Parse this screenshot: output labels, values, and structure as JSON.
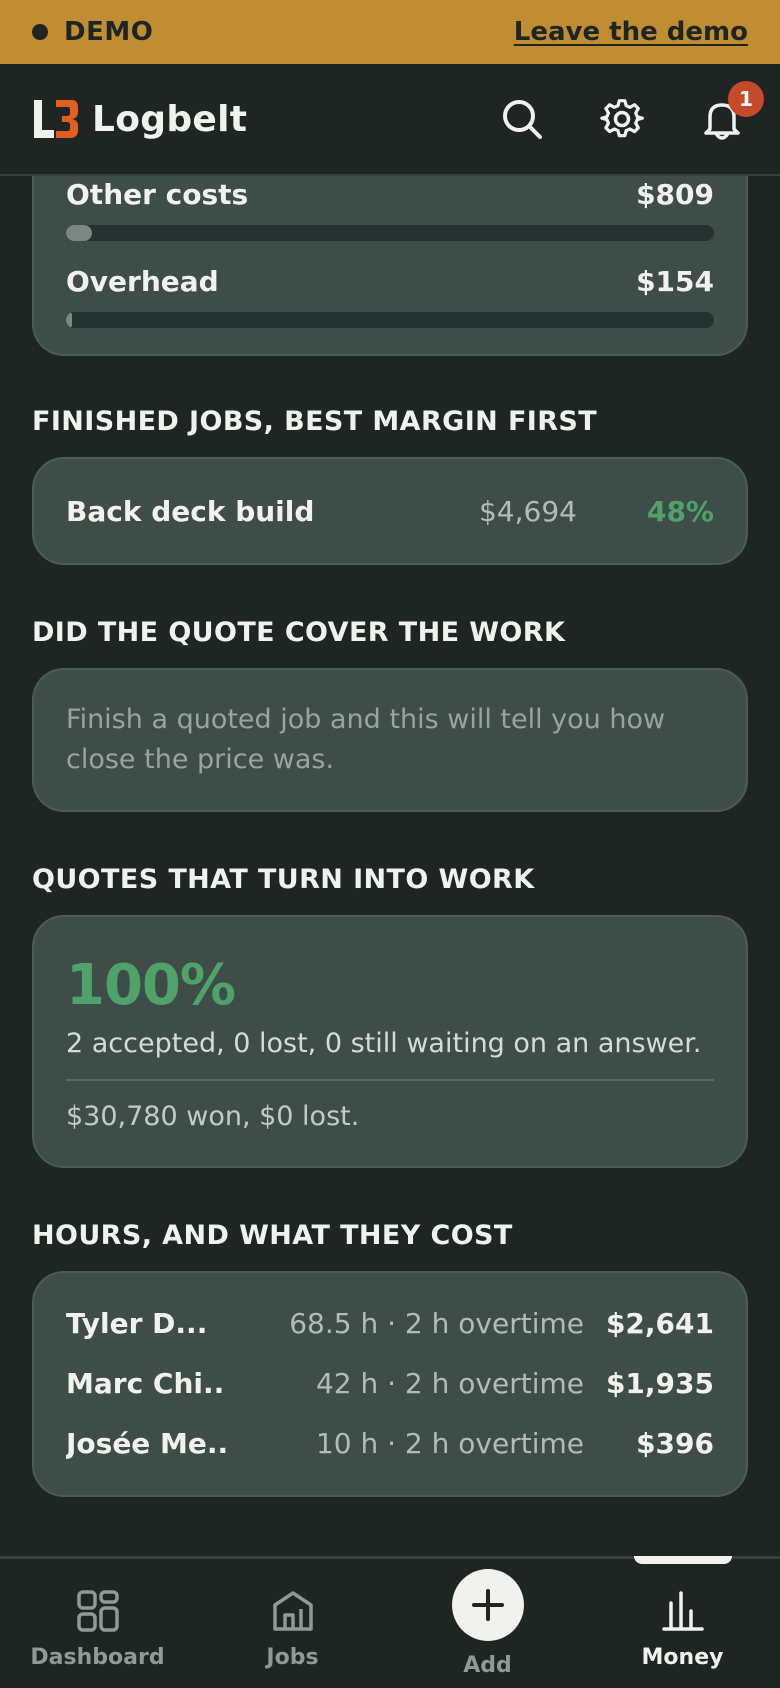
{
  "demo": {
    "label": "DEMO",
    "leave_link": "Leave the demo"
  },
  "header": {
    "brand": "Logbelt",
    "notification_count": "1"
  },
  "costs": [
    {
      "label": "Other costs",
      "amount": "$809",
      "fill_fraction": 0.04
    },
    {
      "label": "Overhead",
      "amount": "$154",
      "fill_fraction": 0.008
    }
  ],
  "finished_jobs": {
    "title": "FINISHED JOBS, BEST MARGIN FIRST",
    "jobs": [
      {
        "name": "Back deck build",
        "amount": "$4,694",
        "margin": "48%"
      }
    ]
  },
  "quote_cover": {
    "title": "DID THE QUOTE COVER THE WORK",
    "message": "Finish a quoted job and this will tell you how close the price was."
  },
  "quote_conversion": {
    "title": "QUOTES THAT TURN INTO WORK",
    "percent": "100%",
    "summary": "2 accepted, 0 lost, 0 still waiting on an answer.",
    "money": "$30,780 won, $0 lost."
  },
  "hours": {
    "title": "HOURS, AND WHAT THEY COST",
    "rows": [
      {
        "name": "Tyler D...",
        "detail": "68.5 h · 2 h overtime",
        "cost": "$2,641"
      },
      {
        "name": "Marc Chi...",
        "detail": "42 h · 2 h overtime",
        "cost": "$1,935"
      },
      {
        "name": "Josée Me...",
        "detail": "10 h · 2 h overtime",
        "cost": "$396"
      }
    ]
  },
  "nav": {
    "dashboard": "Dashboard",
    "jobs": "Jobs",
    "add": "Add",
    "money": "Money"
  },
  "colors": {
    "accent_banner": "#c08d33",
    "positive": "#4fa36a",
    "badge": "#c44a2a"
  }
}
